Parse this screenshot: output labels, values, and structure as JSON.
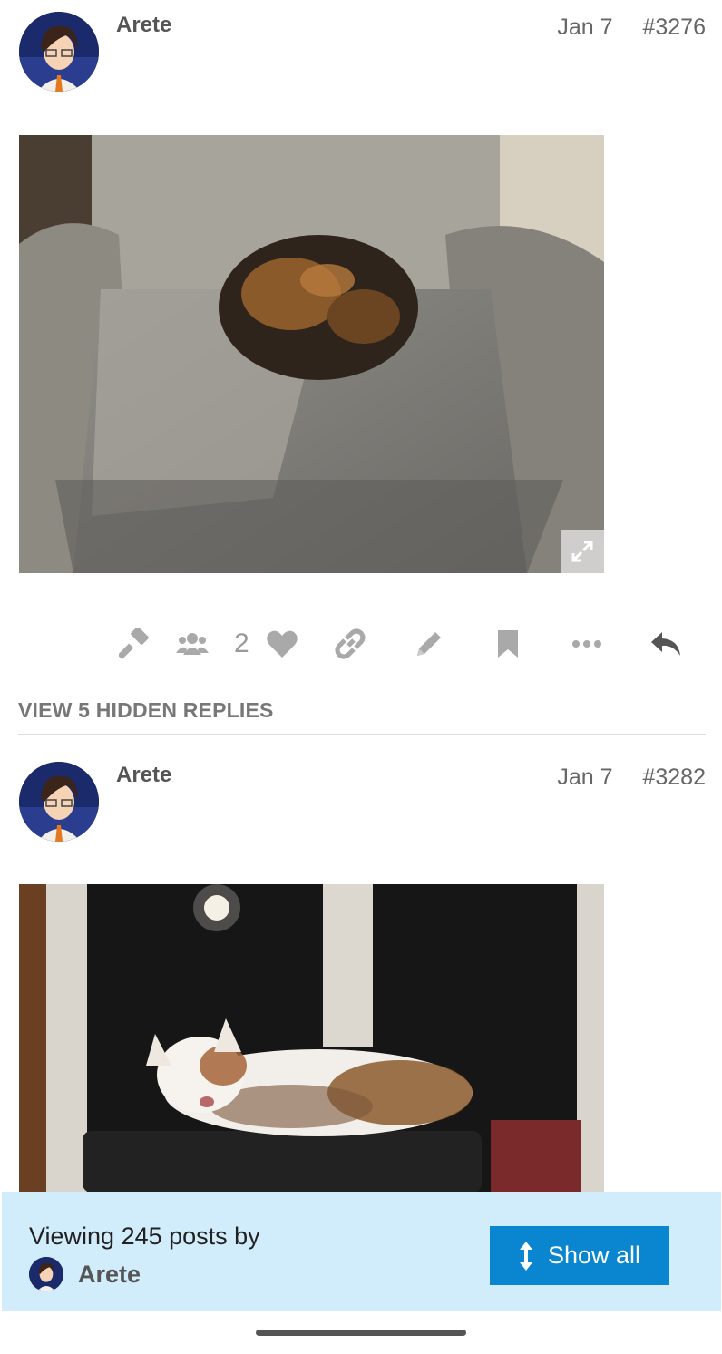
{
  "posts": [
    {
      "username": "Arete",
      "date": "Jan 7",
      "post_number": "#3276",
      "image_icon": "expand-icon"
    },
    {
      "username": "Arete",
      "date": "Jan 7",
      "post_number": "#3282"
    }
  ],
  "actions": {
    "like_count": "2",
    "icons": [
      "admin-wrench-icon",
      "group-icon",
      "heart-icon",
      "link-icon",
      "pencil-icon",
      "bookmark-icon",
      "more-icon",
      "reply-icon"
    ]
  },
  "hidden_replies_label": "VIEW 5 HIDDEN REPLIES",
  "filter_bar": {
    "text": "Viewing 245 posts by",
    "username": "Arete",
    "button_label": "Show all",
    "button_icon": "vertical-arrows-icon"
  },
  "colors": {
    "accent": "#0a86d0",
    "filter_bg": "#d1edfb"
  }
}
